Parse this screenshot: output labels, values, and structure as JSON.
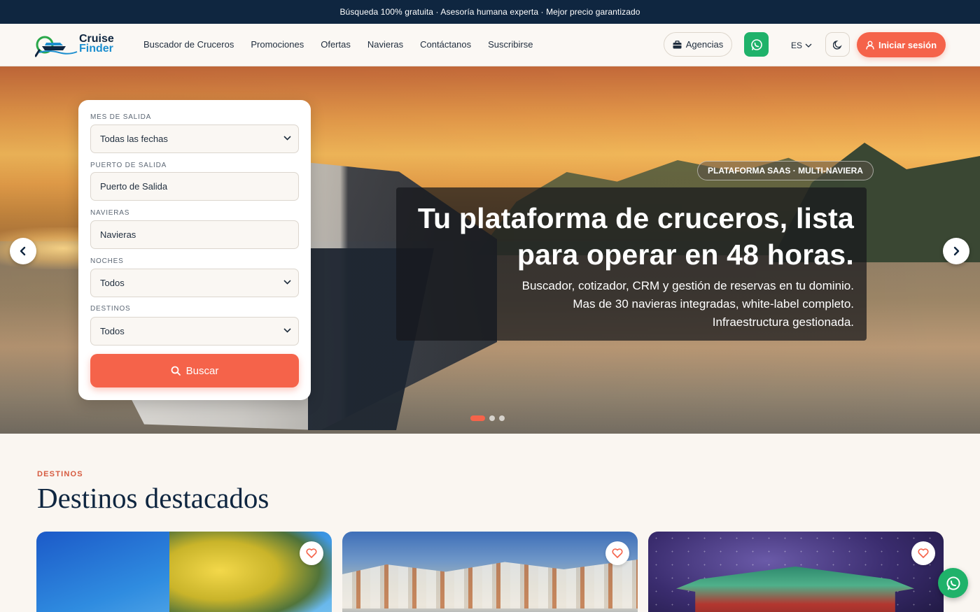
{
  "topbar": {
    "text": "Búsqueda 100% gratuita · Asesoría humana experta · Mejor precio garantizado"
  },
  "logo": {
    "line1": "Cruise",
    "line2": "Finder"
  },
  "nav": {
    "items": [
      "Buscador de Cruceros",
      "Promociones",
      "Ofertas",
      "Navieras",
      "Contáctanos",
      "Suscribirse"
    ]
  },
  "header": {
    "agencias_label": "Agencias",
    "lang_label": "ES",
    "login_label": "Iniciar sesión"
  },
  "search": {
    "fields": [
      {
        "label": "MES DE SALIDA",
        "value": "Todas las fechas",
        "type": "select"
      },
      {
        "label": "PUERTO DE SALIDA",
        "value": "Puerto de Salida",
        "type": "input"
      },
      {
        "label": "NAVIERAS",
        "value": "Navieras",
        "type": "input"
      },
      {
        "label": "NOCHES",
        "value": "Todos",
        "type": "select"
      },
      {
        "label": "DESTINOS",
        "value": "Todos",
        "type": "select"
      }
    ],
    "button_label": "Buscar"
  },
  "hero": {
    "tag": "PLATAFORMA SAAS · MULTI-NAVIERA",
    "title_line1": "Tu plataforma de cruceros, lista",
    "title_line2": "para operar en 48 horas.",
    "subtitle_line1": "Buscador, cotizador, CRM y gestión de reservas en tu dominio.",
    "subtitle_line2": "Mas de 30 navieras integradas, white-label completo.",
    "subtitle_line3": "Infraestructura gestionada.",
    "slides_total": 3,
    "active_slide": 1
  },
  "destinations": {
    "eyebrow": "DESTINOS",
    "title": "Destinos destacados"
  },
  "colors": {
    "accent": "#f5634a",
    "navy": "#0f2640",
    "whatsapp": "#1fb26a"
  }
}
